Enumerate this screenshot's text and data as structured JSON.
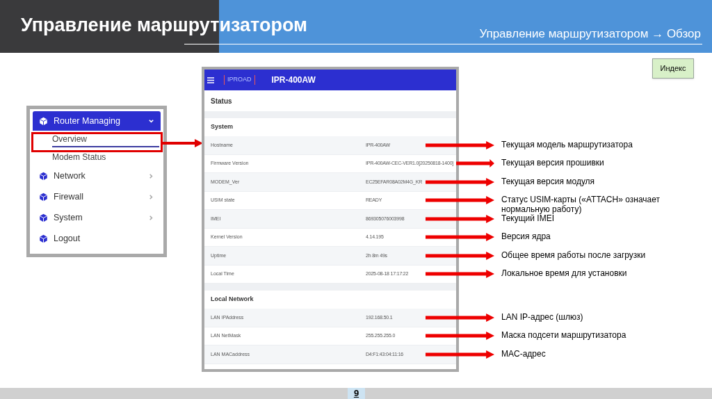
{
  "header": {
    "title": "Управление маршрутизатором",
    "breadcrumb": "Управление маршрутизатором → Обзор"
  },
  "index_button": "Индекс",
  "sidebar_screenshot": {
    "items": [
      {
        "kind": "group",
        "label": "Router Managing",
        "expanded": true,
        "children": [
          {
            "label": "Overview",
            "selected": true
          },
          {
            "label": "Modem Status",
            "selected": false
          }
        ]
      },
      {
        "kind": "group",
        "label": "Network",
        "expanded": false
      },
      {
        "kind": "group",
        "label": "Firewall",
        "expanded": false
      },
      {
        "kind": "group",
        "label": "System",
        "expanded": false
      },
      {
        "kind": "action",
        "label": "Logout"
      }
    ]
  },
  "status_screenshot": {
    "logo": "IPROAD",
    "model": "IPR-400AW",
    "page_title": "Status",
    "sections": [
      {
        "title": "System",
        "rows": [
          {
            "label": "Hostname",
            "value": "IPR-400AW",
            "note": "Текущая модель маршрутизатора"
          },
          {
            "label": "Firmware Version",
            "value": "IPR-400AW-CEC-VER1.0[20250818-1400]",
            "note": "Текущая версия прошивки"
          },
          {
            "label": "MODEM_Ver",
            "value": "EC25EFAR08A02M4G_KR",
            "note": "Текущая версия модуля"
          },
          {
            "label": "USIM state",
            "value": "READY",
            "note": "Статус USIM-карты («ATTACH» означает нормальную работу)"
          },
          {
            "label": "IMEI",
            "value": "869305076003998",
            "note": "Текущий IMEI"
          },
          {
            "label": "Kernel Version",
            "value": "4.14.195",
            "note": "Версия ядра"
          },
          {
            "label": "Uptime",
            "value": "2h 8m 49s",
            "note": "Общее время работы после загрузки"
          },
          {
            "label": "Local Time",
            "value": "2025-08-18 17:17:22",
            "note": "Локальное время для установки"
          }
        ]
      },
      {
        "title": "Local Network",
        "rows": [
          {
            "label": "LAN IPAddress",
            "value": "192.168.50.1",
            "note": "LAN IP-адрес (шлюз)"
          },
          {
            "label": "LAN NetMask",
            "value": "255.255.255.0",
            "note": "Маска подсети маршрутизатора"
          },
          {
            "label": "LAN MACaddress",
            "value": "D4:F1:43:04:11:16",
            "note": "MAC-адрес"
          }
        ]
      }
    ]
  },
  "page_number": "9"
}
